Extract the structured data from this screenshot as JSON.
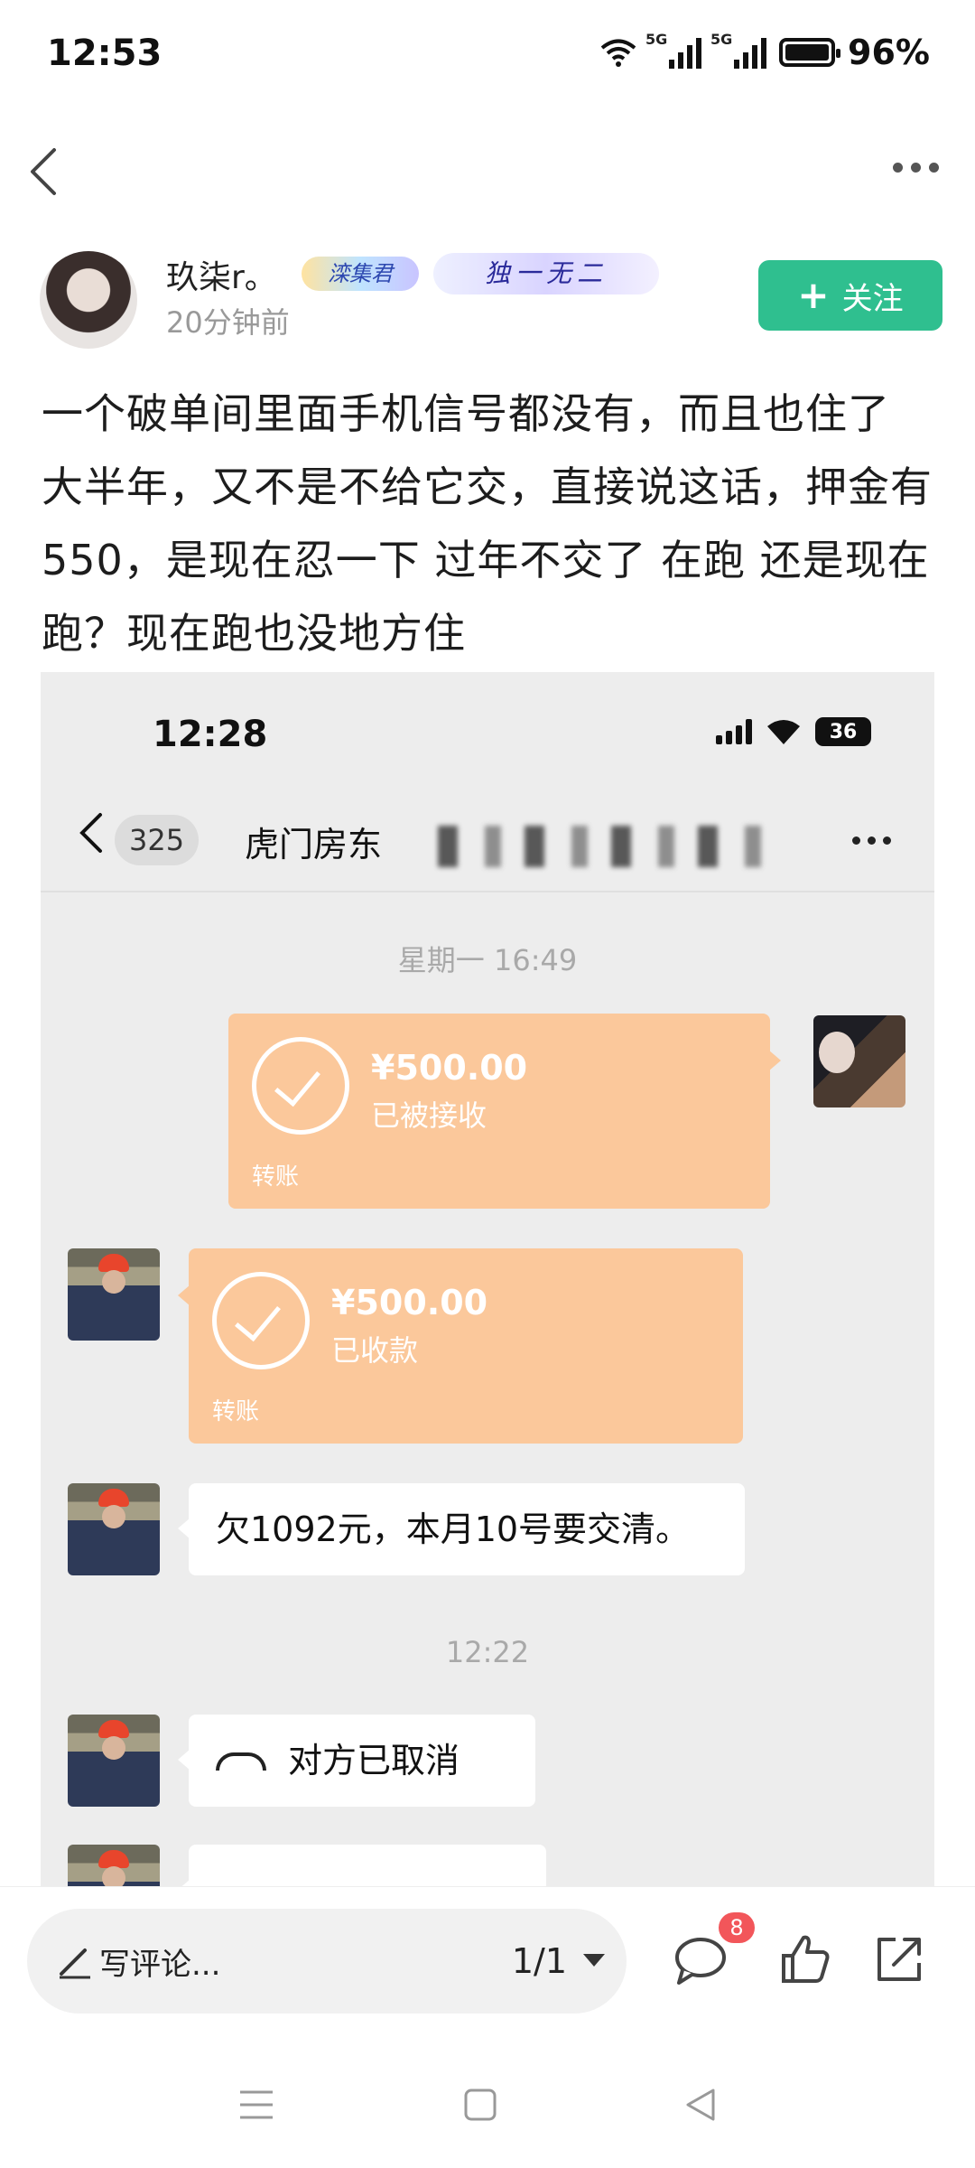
{
  "status_bar": {
    "time": "12:53",
    "network1": "5G",
    "network2": "5G",
    "battery": "96%"
  },
  "author": {
    "name": "玖柒r。",
    "badge1": "滦集君",
    "badge2": "独一无二",
    "post_time": "20分钟前",
    "follow_label": "关注",
    "follow_color": "#2fbf8f"
  },
  "post": {
    "text": "一个破单间里面手机信号都没有，而且也住了 大半年，又不是不给它交，直接说这话，押金有550，是现在忍一下 过年不交了 在跑 还是现在跑？现在跑也没地方住"
  },
  "embedded_chat": {
    "status_time": "12:28",
    "battery": "36",
    "unread_count": "325",
    "chat_title": "虎门房东",
    "messages": [
      {
        "type": "timestamp",
        "text": "星期一 16:49"
      },
      {
        "type": "transfer",
        "side": "right",
        "amount": "¥500.00",
        "status": "已被接收",
        "kind": "转账"
      },
      {
        "type": "transfer",
        "side": "left",
        "amount": "¥500.00",
        "status": "已收款",
        "kind": "转账"
      },
      {
        "type": "text",
        "side": "left",
        "text": "欠1092元，本月10号要交清。"
      },
      {
        "type": "timestamp",
        "text": "12:22"
      },
      {
        "type": "call",
        "side": "left",
        "text": "对方已取消"
      }
    ],
    "transfer_color": "#fbc89b"
  },
  "bottom_bar": {
    "comment_placeholder": "写评论...",
    "page_indicator": "1/1",
    "comment_count": "8"
  }
}
